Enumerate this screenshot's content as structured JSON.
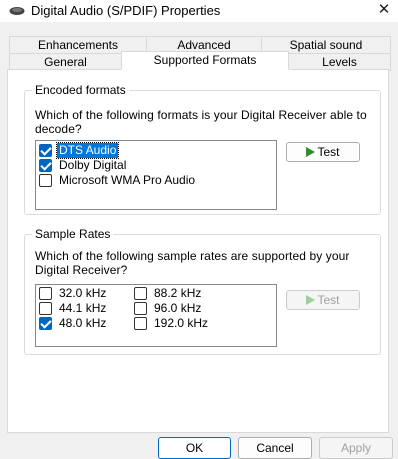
{
  "window": {
    "title": "Digital Audio (S/PDIF) Properties",
    "close_glyph": "✕"
  },
  "tabs": {
    "row1": [
      "Enhancements",
      "Advanced",
      "Spatial sound"
    ],
    "row2": [
      "General",
      "Supported Formats",
      "Levels"
    ],
    "active": "Supported Formats"
  },
  "encoded_formats": {
    "legend": "Encoded formats",
    "question_line1": "Which of the following formats is your Digital Receiver able to",
    "question_line2": "decode?",
    "items": [
      {
        "label": "DTS Audio",
        "checked": true,
        "selected": true
      },
      {
        "label": "Dolby Digital",
        "checked": true,
        "selected": false
      },
      {
        "label": "Microsoft WMA Pro Audio",
        "checked": false,
        "selected": false
      }
    ],
    "test_button": "Test",
    "test_enabled": true
  },
  "sample_rates": {
    "legend": "Sample Rates",
    "question_line1": "Which of the following sample rates are supported by your",
    "question_line2": "Digital Receiver?",
    "items": [
      {
        "label": "32.0 kHz",
        "checked": false
      },
      {
        "label": "44.1 kHz",
        "checked": false
      },
      {
        "label": "48.0 kHz",
        "checked": true
      },
      {
        "label": "88.2 kHz",
        "checked": false
      },
      {
        "label": "96.0 kHz",
        "checked": false
      },
      {
        "label": "192.0 kHz",
        "checked": false
      }
    ],
    "test_button": "Test",
    "test_enabled": false
  },
  "footer": {
    "ok": "OK",
    "cancel": "Cancel",
    "apply": "Apply",
    "apply_enabled": false
  },
  "colors": {
    "accent": "#0067c0",
    "selection": "#0078d7",
    "play_icon": "#2e8b2e"
  }
}
